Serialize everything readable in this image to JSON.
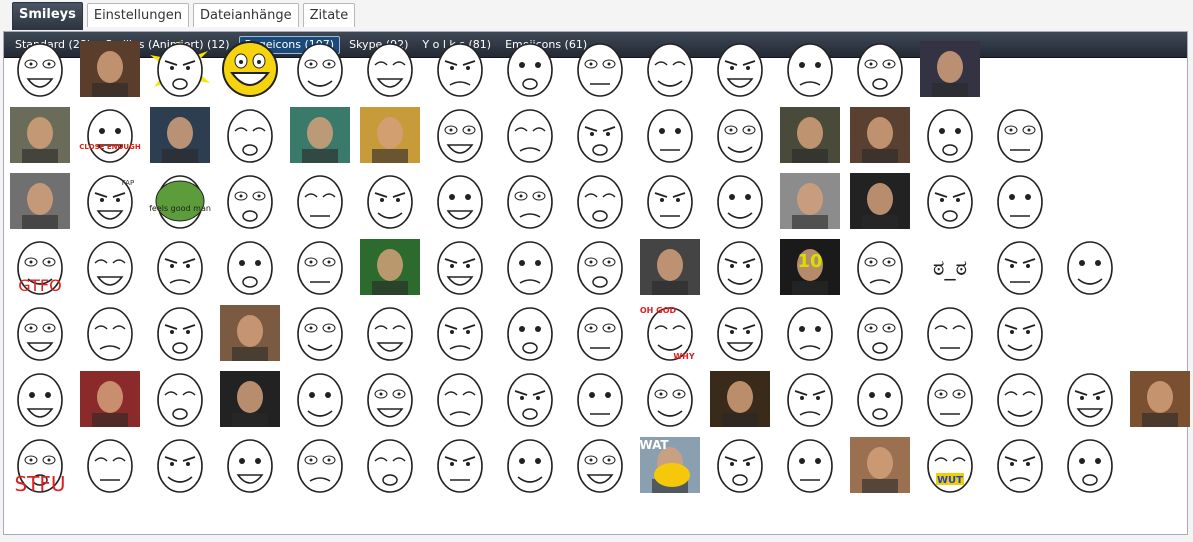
{
  "tabs": [
    {
      "label": "Smileys",
      "active": true
    },
    {
      "label": "Einstellungen",
      "active": false
    },
    {
      "label": "Dateianhänge",
      "active": false
    },
    {
      "label": "Zitate",
      "active": false
    }
  ],
  "categories": [
    {
      "label": "Standard (28)",
      "active": false
    },
    {
      "label": "Smilies (Animiert) (12)",
      "active": false
    },
    {
      "label": "Rageicons (107)",
      "active": true
    },
    {
      "label": "Skype (92)",
      "active": false
    },
    {
      "label": "Y o l k s (81)",
      "active": false
    },
    {
      "label": "Emojicons (61)",
      "active": false
    }
  ],
  "smileys": {
    "rows": [
      [
        "rage-face-smiley",
        "aliens-guy-smiley",
        "all-the-things-smiley",
        "epic-smiley-smiley",
        "laughing-smiley",
        "sneaky-smiley",
        "not-bad-smiley",
        "are-you-kidding-smiley",
        "crying-smiley",
        "happy-cry-smiley",
        "computer-guy-smiley",
        "cereal-guy-smiley",
        "challenge-smiley",
        "dark-photo-smiley"
      ],
      [
        "old-man-photo-smiley",
        "close-enough-smiley",
        "movie-scene-smiley",
        "dancing-troll-smiley",
        "cartoon-kid-smiley",
        "dog-meme-smiley",
        "scared-smiley",
        "serious-smiley",
        "yao-ming-smiley",
        "duck-smiley",
        "meh-smiley",
        "man-photo-smiley",
        "fat-man-photo-smiley",
        "thumbs-up-smiley",
        "troll-smiley"
      ],
      [
        "cheering-photo-smiley",
        "fap-smiley",
        "feels-good-smiley",
        "rage-small-smiley",
        "fffuu-smiley",
        "desk-flip-smiley",
        "forever-alone-smiley",
        "forever-alone-happy-smiley",
        "like-a-sir-smiley",
        "yes-smiley",
        "ragemaster-smiley",
        "computer-stare-smiley",
        "excited-smiley",
        "pink-troll-smiley",
        "sad-smiley"
      ],
      [
        "gtfo-smiley",
        "derp-smiley",
        "herp-smiley",
        "creepy-smiley",
        "mmm-smiley",
        "high-expectations-smiley",
        "frankenstein-smiley",
        "chinese-smiley",
        "pfft-smiley",
        "jackie-chan-smiley",
        "are-you-serious-smiley",
        "ten-photo-smiley",
        "i-lied-smiley",
        "look-of-disapproval-smiley",
        "omg-smiley",
        "pokerface-smiley"
      ],
      [
        "me-gusta-smiley",
        "party-troll-smiley",
        "spread-eyes-smiley",
        "old-photo-smiley",
        "lol-smiley",
        "table-smiley",
        "walking-smiley",
        "okay-smiley",
        "obama-smiley",
        "oh-god-why-smiley",
        "disgust-smiley",
        "okay-face-smiley",
        "fuuu-smiley",
        "fuuu-text-smiley",
        "facepalm-smiley"
      ],
      [
        "poker-smiley",
        "michael-photo-smiley",
        "grin-troll-smiley",
        "zombie-smiley",
        "fuuuu-small-smiley",
        "angry-eyes-smiley",
        "annoyed-smiley",
        "confused-smiley",
        "party-meme-smiley",
        "grumpy-smiley",
        "shaq-smiley",
        "success-kid-smiley",
        "rage-pointing-smiley",
        "disappointed-smiley",
        "happy-tears-smiley",
        "gentleman-smiley",
        "scumbag-smiley"
      ],
      [
        "stfu-smiley",
        "wide-eyes-smiley",
        "monopoly-smiley",
        "suspicious-smiley",
        "tongue-smiley",
        "pipe-smiley",
        "you-dont-say-smiley",
        "sweet-jesus-smiley",
        "thinking-smiley",
        "wat-duck-smiley",
        "not-bad-face-smiley",
        "bitch-please-smiley",
        "bald-man-photo-smiley",
        "wut-smiley",
        "bitch-face-smiley",
        "y-u-no-smiley"
      ]
    ],
    "captions": {
      "close_enough": "CLOSE ENOUGH",
      "feels_good": "feels good man",
      "gtfo": "GTFO",
      "oh_god": "OH GOD",
      "why": "WHY",
      "wat": "WAT",
      "stfu": "STFU",
      "ten": "10",
      "wut": "WUT",
      "fap": "FAP",
      "look": "ಠ_ಠ"
    }
  }
}
